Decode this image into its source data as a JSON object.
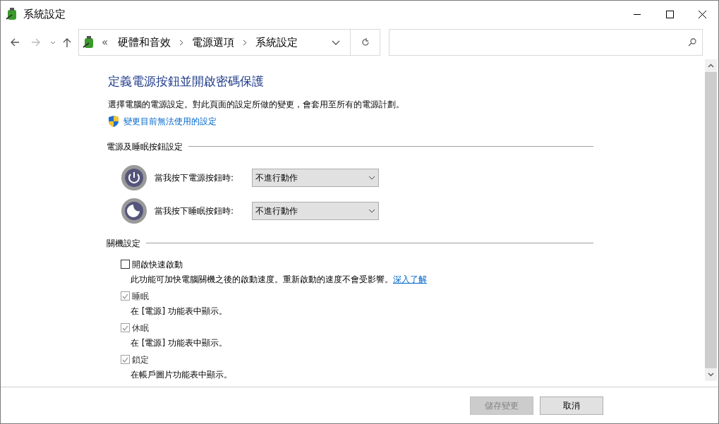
{
  "window": {
    "title": "系統設定"
  },
  "address_bar": {
    "overflow": "«",
    "crumbs": [
      "硬體和音效",
      "電源選項",
      "系統設定"
    ]
  },
  "heading": "定義電源按鈕並開啟密碼保護",
  "description": "選擇電腦的電源設定。對此頁面的設定所做的變更，會套用至所有的電源計劃。",
  "admin_link": "變更目前無法使用的設定",
  "button_section": {
    "title": "電源及睡眠按鈕設定",
    "rows": [
      {
        "kind": "power",
        "label": "當我按下電源按鈕時:",
        "value": "不進行動作"
      },
      {
        "kind": "sleep",
        "label": "當我按下睡眠按鈕時:",
        "value": "不進行動作"
      }
    ]
  },
  "shutdown_section": {
    "title": "關機設定",
    "options": [
      {
        "label": "開啟快速啟動",
        "checked": false,
        "disabled": false,
        "note": "此功能可加快電腦關機之後的啟動速度。重新啟動的速度不會受影響。",
        "link": "深入了解"
      },
      {
        "label": "睡眠",
        "checked": true,
        "disabled": true,
        "note": "在 [電源] 功能表中顯示。"
      },
      {
        "label": "休眠",
        "checked": true,
        "disabled": true,
        "note": "在 [電源] 功能表中顯示。"
      },
      {
        "label": "鎖定",
        "checked": true,
        "disabled": true,
        "note": "在帳戶圖片功能表中顯示。"
      }
    ]
  },
  "buttons": [
    {
      "label": "儲存變更",
      "disabled": true
    },
    {
      "label": "取消",
      "disabled": false
    }
  ]
}
